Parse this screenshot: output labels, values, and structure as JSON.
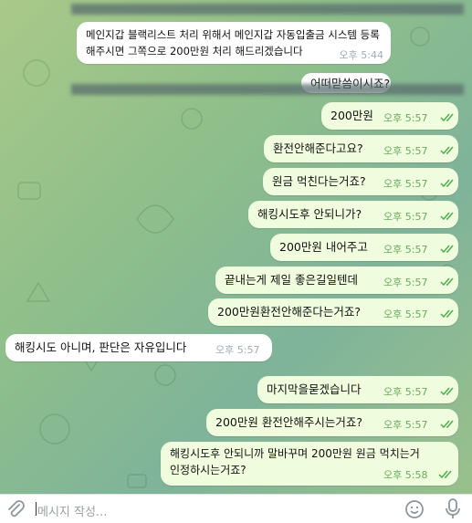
{
  "top_message": {
    "line1": "메인지갑 블랙리스트 처리 위해서 메인지갑 자동입출금 시스템 등록",
    "line2": "해주시면 그쪽으로 200만원 처리 해드리겠습니다",
    "time": "오후 5:44"
  },
  "partial_message": {
    "text": "어떠맏씀이시죠?"
  },
  "messages": [
    {
      "text": "200만원",
      "time": "오후 5:57"
    },
    {
      "text": "환전안해준다고요?",
      "time": "오후 5:57"
    },
    {
      "text": "원금 먹친다는거죠?",
      "time": "오후 5:57"
    },
    {
      "text": "해킹시도후 안되니가?",
      "time": "오후 5:57"
    },
    {
      "text": "200만원 내어주고",
      "time": "오후 5:57"
    },
    {
      "text": "끝내는게 제일 좋은길일텐데",
      "time": "오후 5:57"
    },
    {
      "text": "200만원환전안해준다는거죠?",
      "time": "오후 5:57"
    },
    {
      "text": "해킹시도 아니며, 판단은 자유입니다",
      "time": "오후 5:57"
    },
    {
      "text": "마지막을묻겠습니다",
      "time": "오후 5:57"
    },
    {
      "text": "200만원 환전안해주시는거죠?",
      "time": "오후 5:57"
    },
    {
      "line1": "해킹시도후 안되니까 말바꾸며 200만원 원금 먹치는거",
      "line2": "인정하시는거죠?",
      "time": "오후 5:58"
    }
  ],
  "input": {
    "placeholder": "메시지 작성..."
  },
  "icons": [
    "attach-icon",
    "emoji-icon",
    "microphone-icon",
    "double-check-icon"
  ],
  "colors": {
    "outgoing": "#effdde",
    "incoming": "#ffffff",
    "check": "#4fae4e"
  }
}
